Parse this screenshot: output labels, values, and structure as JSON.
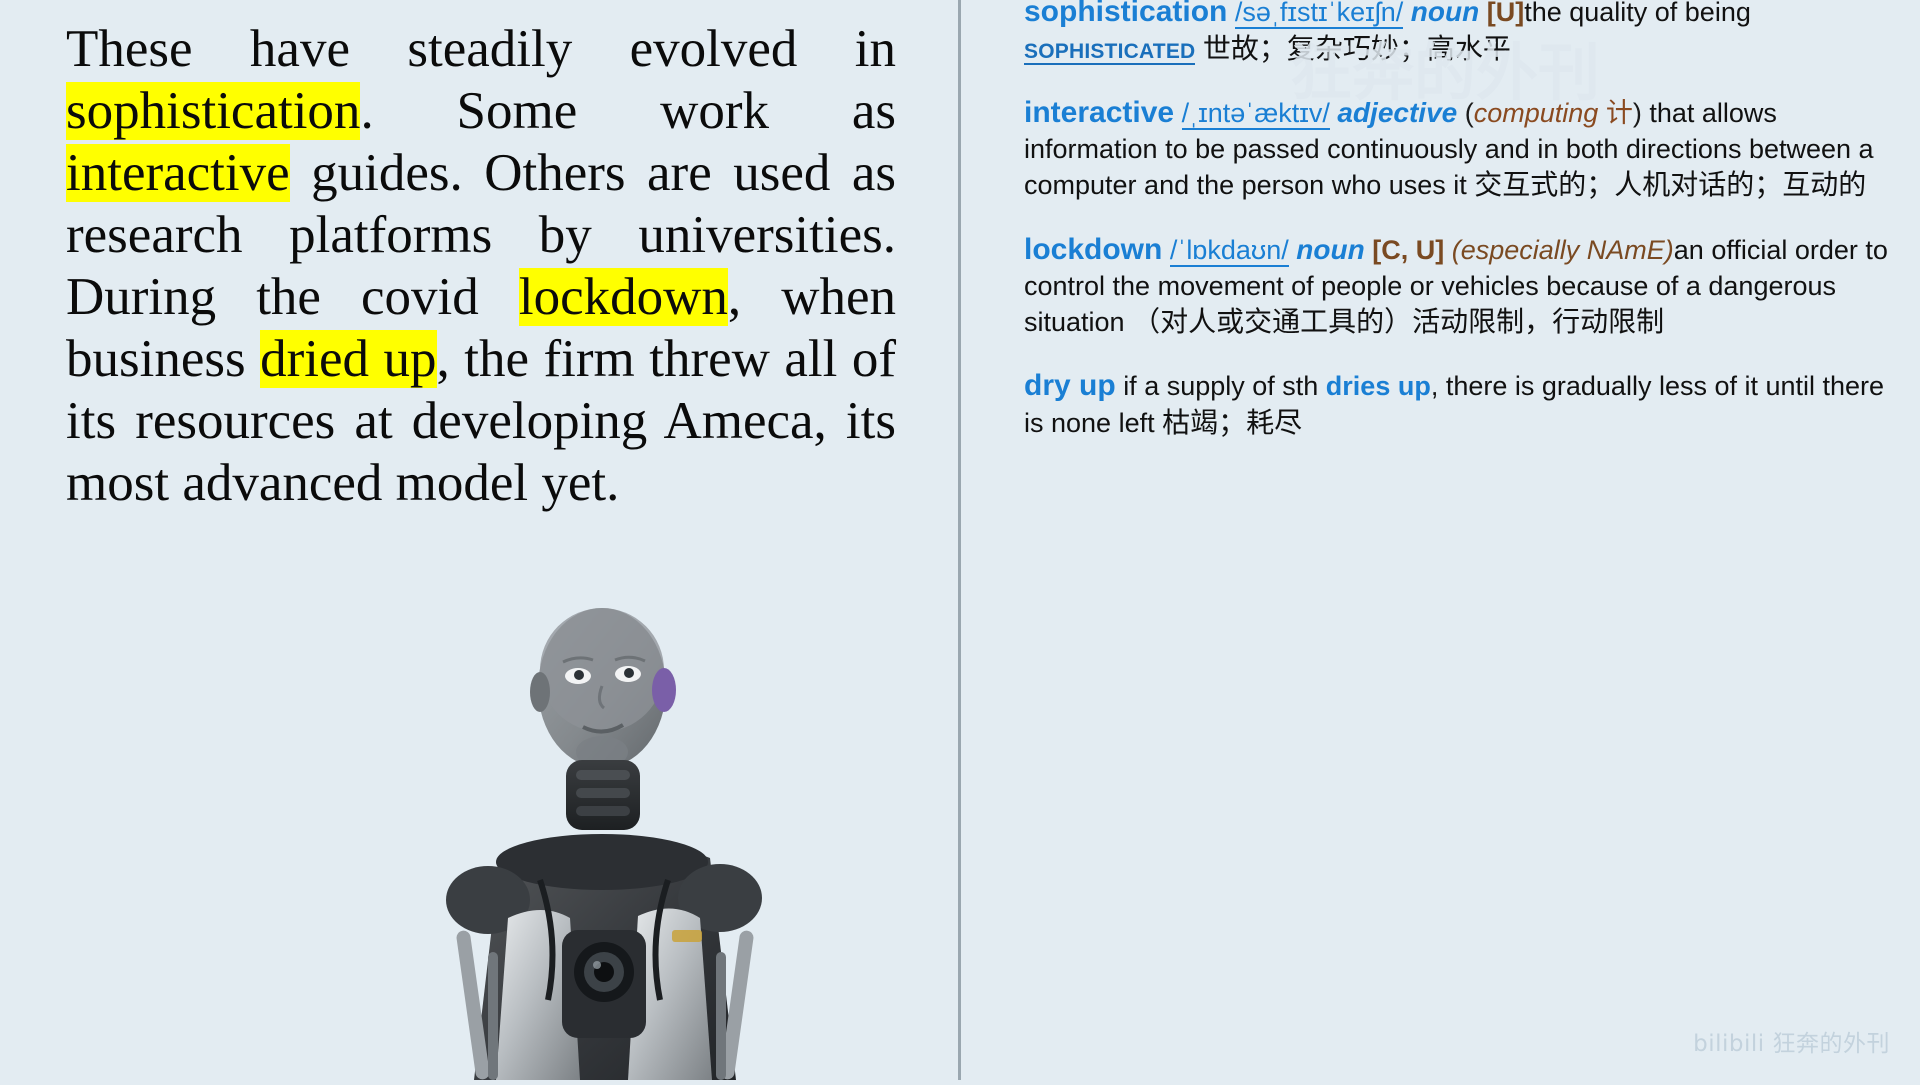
{
  "background_color": "#e3ecf2",
  "accent_color": "#1a7fd4",
  "highlight_color": "#ffff00",
  "grammar_color": "#7a4a22",
  "passage": {
    "segments": [
      {
        "text": "These have steadily evolved in ",
        "highlight": false
      },
      {
        "text": "sophistication",
        "highlight": true
      },
      {
        "text": ". Some work as ",
        "highlight": false
      },
      {
        "text": "interactive",
        "highlight": true
      },
      {
        "text": " guides. Others are used as research platforms by universities. During the covid ",
        "highlight": false
      },
      {
        "text": "lockdown",
        "highlight": true
      },
      {
        "text": ", when business ",
        "highlight": false
      },
      {
        "text": "dried up",
        "highlight": true
      },
      {
        "text": ", the firm threw all of its resources at developing Ameca, its most advanced model yet.",
        "highlight": false
      }
    ],
    "plain_text": "These have steadily evolved in sophistication. Some work as interactive guides. Others are used as research platforms by universities. During the covid lockdown, when business dried up, the firm threw all of its resources at developing Ameca, its most advanced model yet."
  },
  "image": {
    "alt": "humanoid robot Ameca bust, grey face, exposed mechanical torso"
  },
  "dictionary": {
    "entries": [
      {
        "headword": "sophistication",
        "ipa": "/səˌfɪstɪˈkeɪʃn/",
        "pos": "noun",
        "grammar": "[U]",
        "definition_before": "the quality of being ",
        "xref": "SOPHISTICATED",
        "definition_after": "",
        "chinese": "世故；复杂巧妙；高水平"
      },
      {
        "headword": "interactive",
        "ipa": "/ˌɪntəˈæktɪv/",
        "pos": "adjective",
        "field": "computing",
        "field_cn": "计",
        "definition": "that allows information to be passed continuously and in both directions between a computer and the person who uses it",
        "chinese": "交互式的；人机对话的；互动的"
      },
      {
        "headword": "lockdown",
        "ipa": "/ˈlɒkdaʊn/",
        "pos": "noun",
        "grammar": "[C, U]",
        "register": "(especially NAmE)",
        "definition": "an official order to control the movement of people or vehicles because of a dangerous situation",
        "chinese": "（对人或交通工具的）活动限制，行动限制"
      },
      {
        "headword": "dry up",
        "definition_before": "if a supply of sth ",
        "inflection": "dries up",
        "definition_after": ", there is gradually less of it until there is none left",
        "chinese": "枯竭；耗尽"
      }
    ]
  },
  "watermark": {
    "text": "bilibili 狂奔的外刊",
    "ghost_text": "狂奔的外刊"
  }
}
